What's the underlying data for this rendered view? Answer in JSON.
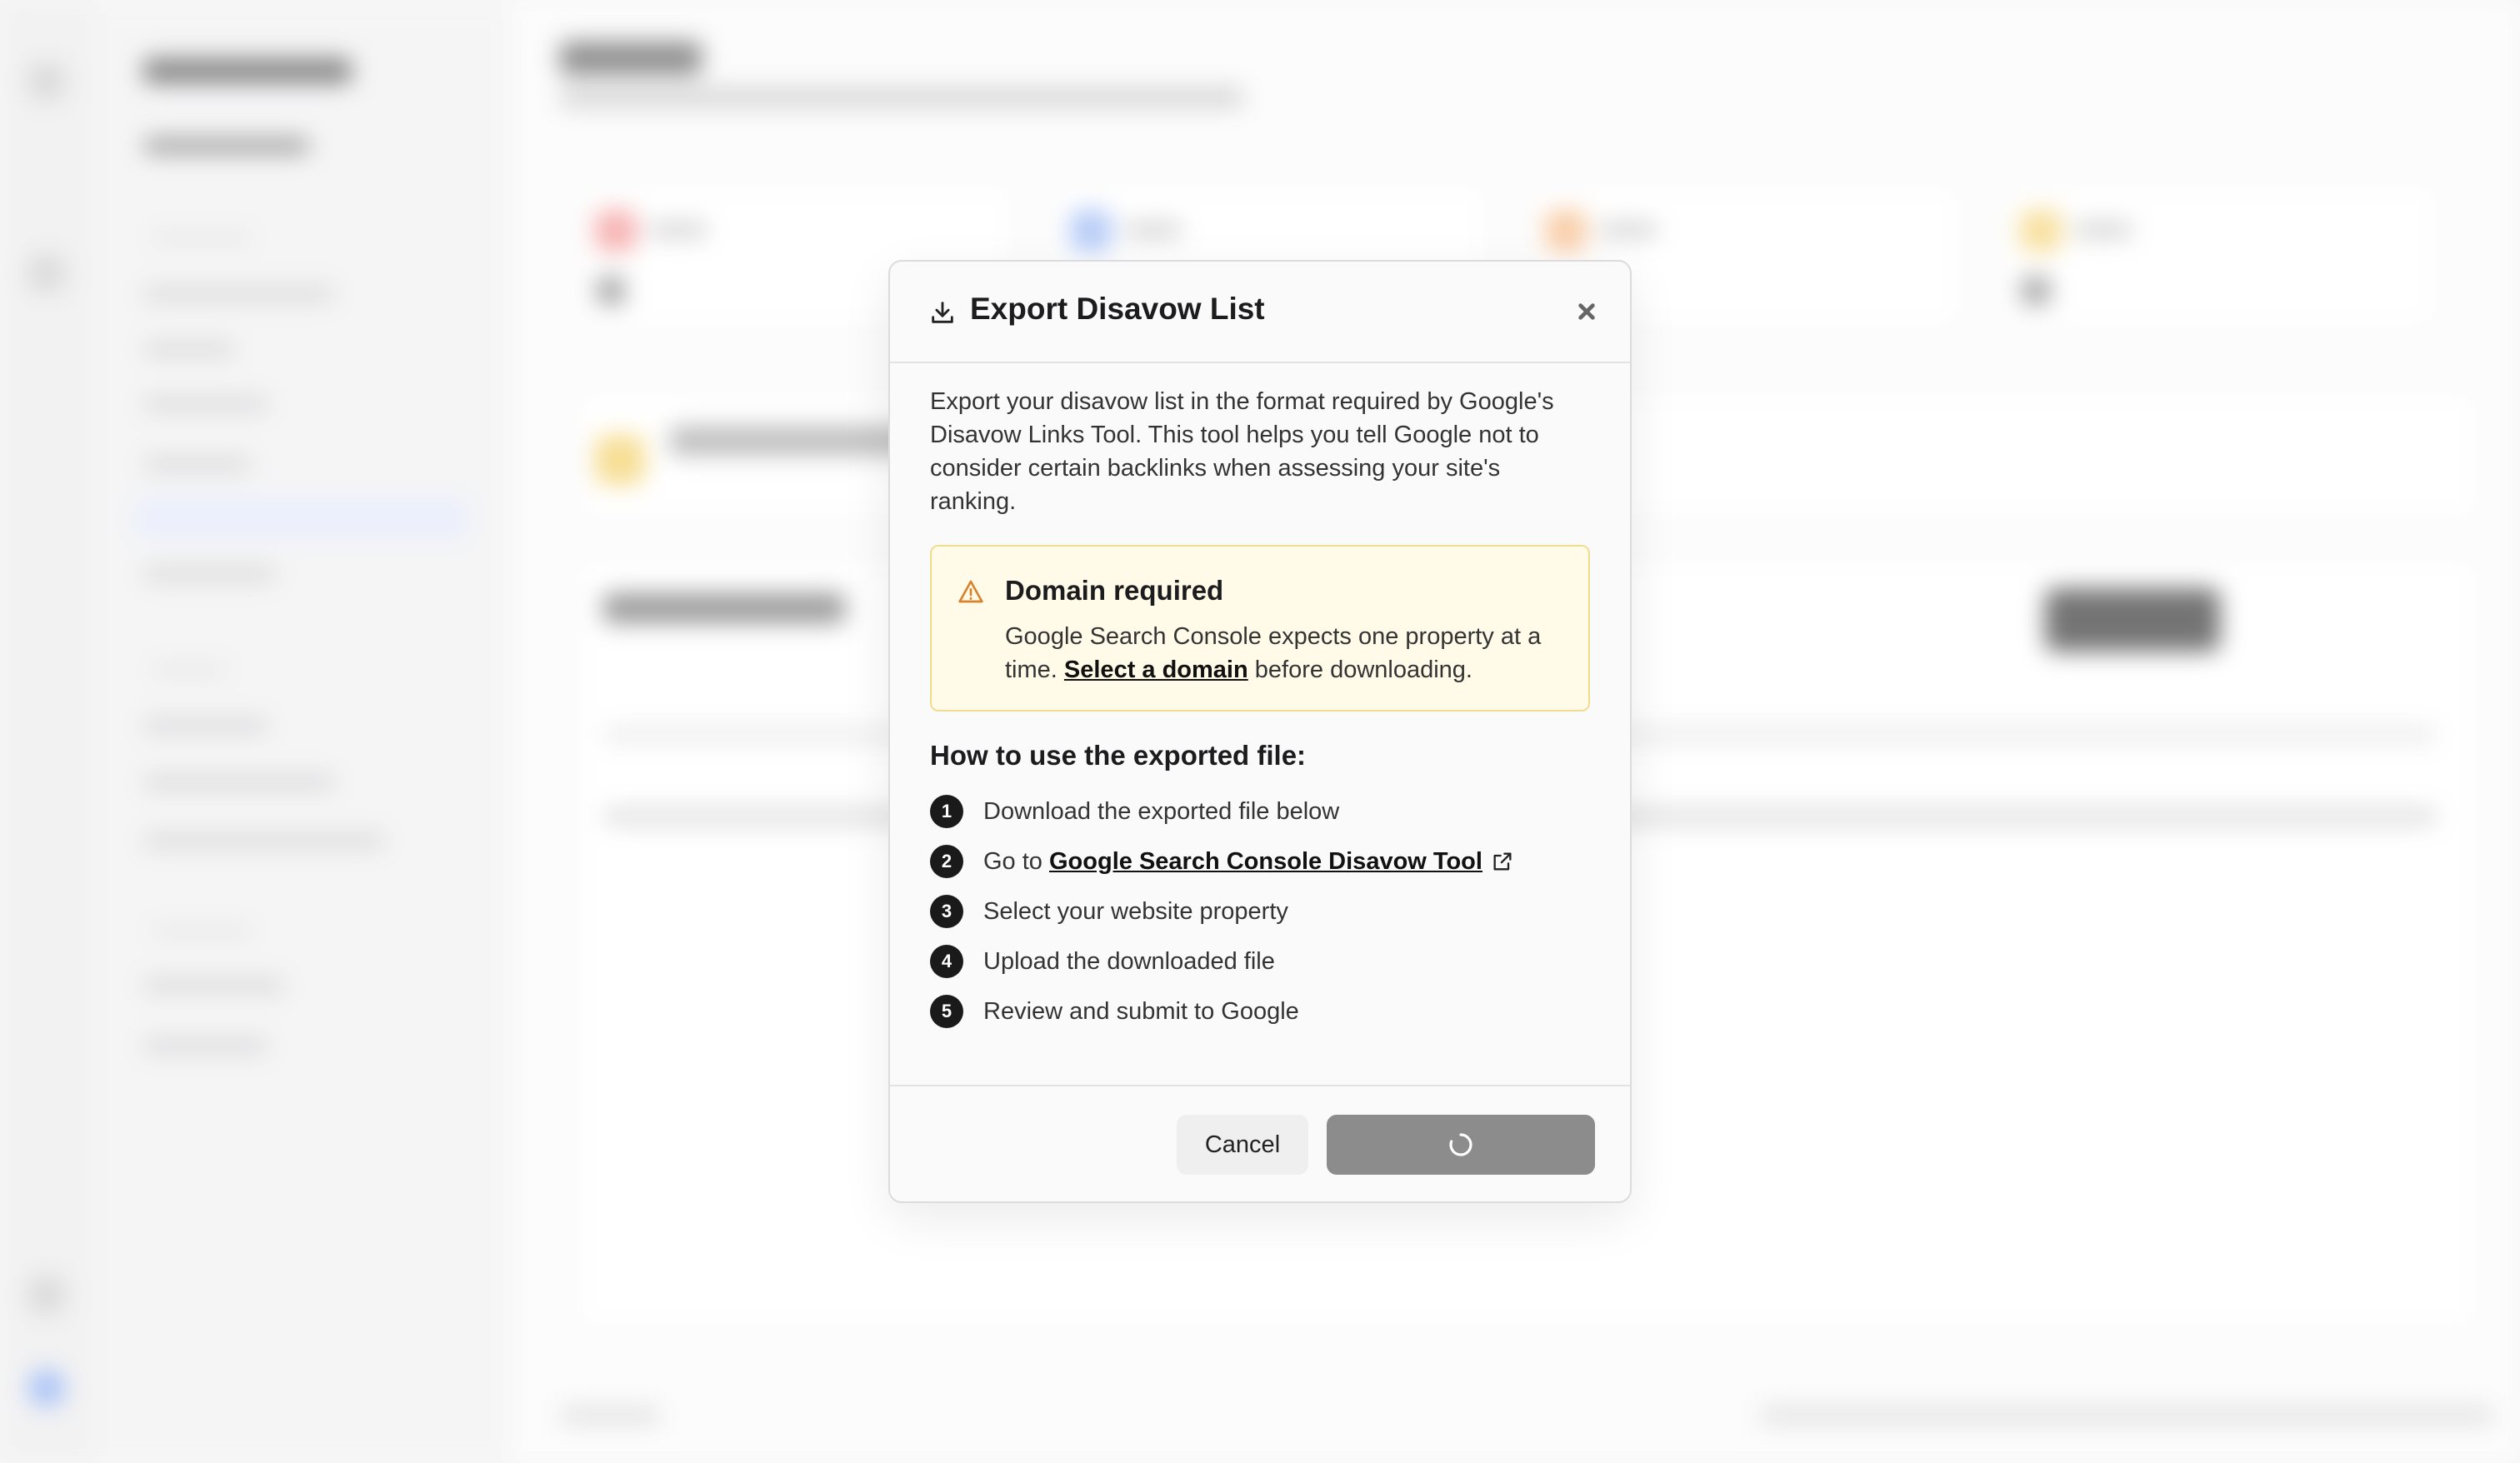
{
  "modal": {
    "title": "Export Disavow List",
    "description": "Export your disavow list in the format required by Google's Disavow Links Tool. This tool helps you tell Google not to consider certain backlinks when assessing your site's ranking.",
    "alert": {
      "title": "Domain required",
      "text_before": "Google Search Console expects one property at a time.",
      "link": "Select a domain",
      "text_after": "before downloading."
    },
    "howto_title": "How to use the exported file:",
    "steps": [
      {
        "num": "1",
        "text": "Download the exported file below"
      },
      {
        "num": "2",
        "prefix": "Go to",
        "link": "Google Search Console Disavow Tool"
      },
      {
        "num": "3",
        "text": "Select your website property"
      },
      {
        "num": "4",
        "text": "Upload the downloaded file"
      },
      {
        "num": "5",
        "text": "Review and submit to Google"
      }
    ],
    "cancel_label": "Cancel",
    "download_state": "loading"
  },
  "icons": {
    "header": "download-icon",
    "close": "close-icon",
    "alert": "warning-icon",
    "external": "external-link-icon",
    "loading": "spinner-icon"
  },
  "colors": {
    "alert_bg": "#fffbe8",
    "alert_border": "#f2dd8f",
    "warning_icon": "#d9822b",
    "step_badge": "#1a1a1a",
    "download_button_disabled": "#8b8c8b"
  }
}
